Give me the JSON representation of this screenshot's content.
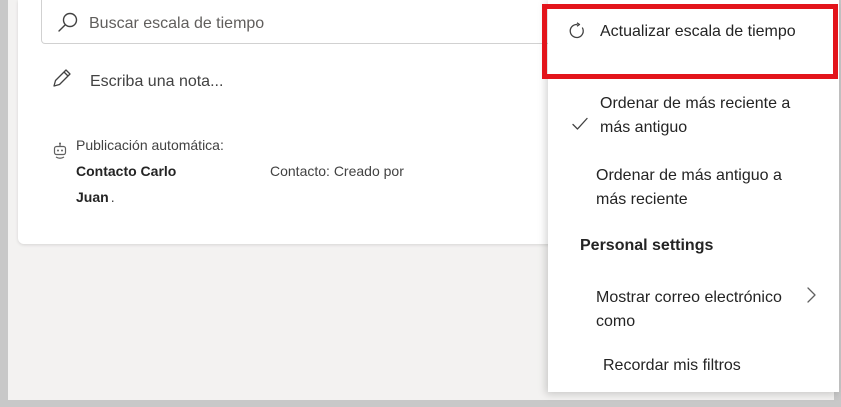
{
  "search": {
    "placeholder": "Buscar escala de tiempo",
    "icon": "search-icon"
  },
  "note": {
    "placeholder": "Escriba una nota...",
    "icon": "pencil-icon"
  },
  "post": {
    "icon": "bot-icon",
    "label": "Publicación automática:",
    "name_line1": "Contacto Carlo",
    "name_line2": "Juan",
    "detail": "Contacto: Creado por"
  },
  "menu": {
    "refresh_label": "Actualizar escala de tiempo",
    "sort_newest_label": "Ordenar de más reciente a más antiguo",
    "sort_oldest_label": "Ordenar de más antiguo a más reciente",
    "section_heading": "Personal settings",
    "show_email_label": "Mostrar correo electrónico como",
    "remember_filters_label": "Recordar mis filtros",
    "highlight_color": "#e3141b"
  }
}
